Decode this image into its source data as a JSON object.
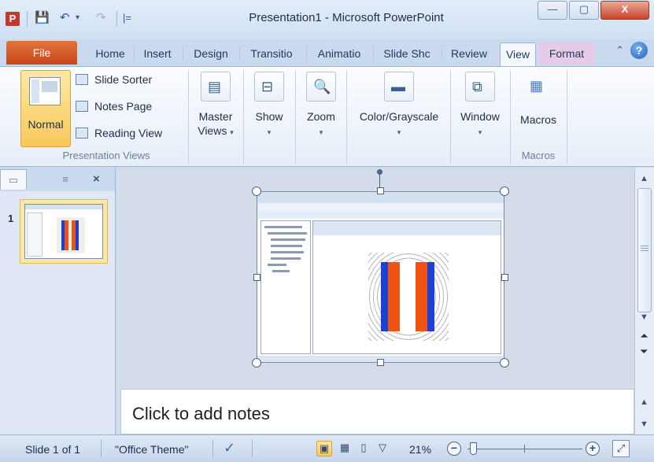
{
  "window": {
    "title": "Presentation1 - Microsoft PowerPoint",
    "app_icon_letter": "P",
    "minimize": "—",
    "maximize": "▢",
    "close": "X"
  },
  "quick_access": {
    "save_icon": "save-icon",
    "undo_icon": "undo-icon",
    "redo_icon": "redo-icon",
    "customize": "|="
  },
  "tabs": {
    "file": "File",
    "items": [
      "Home",
      "Insert",
      "Design",
      "Transitio",
      "Animatio",
      "Slide Shc",
      "Review",
      "View",
      "Format"
    ],
    "active": "View",
    "minimize_ribbon": "ⓧ",
    "help": "?"
  },
  "ribbon": {
    "presentation_views": {
      "label": "Presentation Views",
      "normal": "Normal",
      "slide_sorter": "Slide Sorter",
      "notes_page": "Notes Page",
      "reading_view": "Reading View"
    },
    "master_views": {
      "line1": "Master",
      "line2": "Views"
    },
    "show": "Show",
    "zoom": "Zoom",
    "color_grayscale": "Color/Grayscale",
    "window": "Window",
    "macros": {
      "button": "Macros",
      "label": "Macros"
    }
  },
  "left_panel": {
    "slide_number": "1",
    "close": "×"
  },
  "notes": {
    "placeholder": "Click to add notes"
  },
  "status_bar": {
    "slide_info": "Slide 1 of 1",
    "theme": "\"Office Theme\"",
    "zoom_percent": "21%",
    "zoom_out": "−",
    "zoom_in": "+"
  },
  "colors": {
    "file_tab": "#c6471a",
    "accent": "#f7c85a",
    "ribbon_bg": "#e6eef8",
    "slide_bar_blue": "#1c3fd6",
    "slide_bar_orange": "#f0520f"
  }
}
